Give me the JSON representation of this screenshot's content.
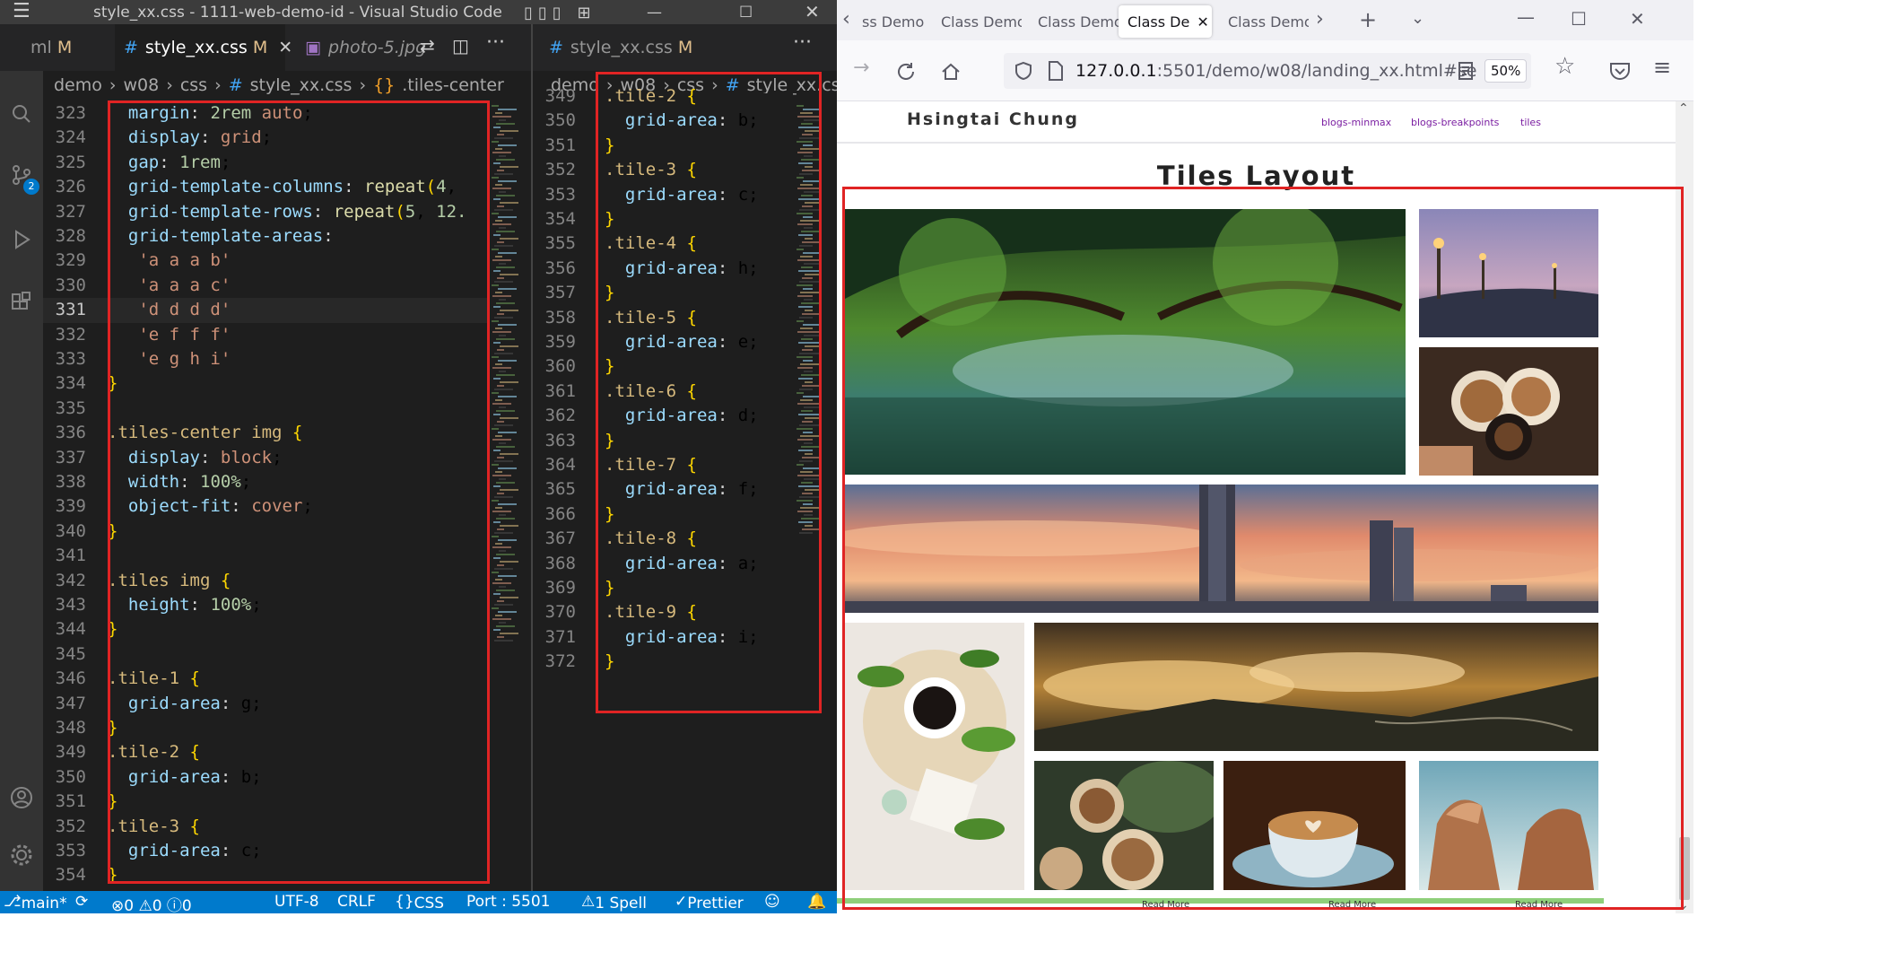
{
  "vscode": {
    "title": "style_xx.css - 1111-web-demo-id - Visual Studio Code",
    "activity_badge": "2",
    "left_group": {
      "tabs": [
        {
          "label": "ml",
          "flag": "M"
        },
        {
          "label": "style_xx.css",
          "flag": "M"
        },
        {
          "label": "photo-5.jpg",
          "flag": ""
        }
      ],
      "breadcrumb": [
        "demo",
        "w08",
        "css",
        "style_xx.css",
        ".tiles-center"
      ]
    },
    "right_group": {
      "tab": {
        "label": "style_xx.css",
        "flag": "M"
      },
      "breadcrumb": [
        "demo",
        "w08",
        "css",
        "style_xx.css"
      ]
    },
    "left_lines": [
      {
        "n": "323",
        "code": "  margin: 2rem auto;"
      },
      {
        "n": "324",
        "code": "  display: grid;"
      },
      {
        "n": "325",
        "code": "  gap: 1rem;"
      },
      {
        "n": "326",
        "code": "  grid-template-columns: repeat(4,"
      },
      {
        "n": "327",
        "code": "  grid-template-rows: repeat(5, 12."
      },
      {
        "n": "328",
        "code": "  grid-template-areas:"
      },
      {
        "n": "329",
        "code": "   'a a a b'"
      },
      {
        "n": "330",
        "code": "   'a a a c'"
      },
      {
        "n": "331",
        "code": "   'd d d d'"
      },
      {
        "n": "332",
        "code": "   'e f f f'"
      },
      {
        "n": "333",
        "code": "   'e g h i'"
      },
      {
        "n": "334",
        "code": "}"
      },
      {
        "n": "335",
        "code": ""
      },
      {
        "n": "336",
        "code": ".tiles-center img {"
      },
      {
        "n": "337",
        "code": "  display: block;"
      },
      {
        "n": "338",
        "code": "  width: 100%;"
      },
      {
        "n": "339",
        "code": "  object-fit: cover;"
      },
      {
        "n": "340",
        "code": "}"
      },
      {
        "n": "341",
        "code": ""
      },
      {
        "n": "342",
        "code": ".tiles img {"
      },
      {
        "n": "343",
        "code": "  height: 100%;"
      },
      {
        "n": "344",
        "code": "}"
      },
      {
        "n": "345",
        "code": ""
      },
      {
        "n": "346",
        "code": ".tile-1 {"
      },
      {
        "n": "347",
        "code": "  grid-area: g;"
      },
      {
        "n": "348",
        "code": "}"
      },
      {
        "n": "349",
        "code": ".tile-2 {"
      },
      {
        "n": "350",
        "code": "  grid-area: b;"
      },
      {
        "n": "351",
        "code": "}"
      },
      {
        "n": "352",
        "code": ".tile-3 {"
      },
      {
        "n": "353",
        "code": "  grid-area: c;"
      },
      {
        "n": "354",
        "code": "}"
      }
    ],
    "right_lines": [
      {
        "n": "349",
        "code": ".tile-2 {"
      },
      {
        "n": "350",
        "code": "  grid-area: b;"
      },
      {
        "n": "351",
        "code": "}"
      },
      {
        "n": "352",
        "code": ".tile-3 {"
      },
      {
        "n": "353",
        "code": "  grid-area: c;"
      },
      {
        "n": "354",
        "code": "}"
      },
      {
        "n": "355",
        "code": ".tile-4 {"
      },
      {
        "n": "356",
        "code": "  grid-area: h;"
      },
      {
        "n": "357",
        "code": "}"
      },
      {
        "n": "358",
        "code": ".tile-5 {"
      },
      {
        "n": "359",
        "code": "  grid-area: e;"
      },
      {
        "n": "360",
        "code": "}"
      },
      {
        "n": "361",
        "code": ".tile-6 {"
      },
      {
        "n": "362",
        "code": "  grid-area: d;"
      },
      {
        "n": "363",
        "code": "}"
      },
      {
        "n": "364",
        "code": ".tile-7 {"
      },
      {
        "n": "365",
        "code": "  grid-area: f;"
      },
      {
        "n": "366",
        "code": "}"
      },
      {
        "n": "367",
        "code": ".tile-8 {"
      },
      {
        "n": "368",
        "code": "  grid-area: a;"
      },
      {
        "n": "369",
        "code": "}"
      },
      {
        "n": "370",
        "code": ".tile-9 {"
      },
      {
        "n": "371",
        "code": "  grid-area: i;"
      },
      {
        "n": "372",
        "code": "}"
      }
    ],
    "current_line": "331",
    "status": {
      "branch": "main*",
      "encoding": "UTF-8",
      "eol": "CRLF",
      "language": "CSS",
      "port": "Port : 5501",
      "spell": "1 Spell",
      "prettier": "Prettier"
    },
    "colors": {
      "status_bar": "#007acc",
      "highlight_box": "#e02424"
    }
  },
  "firefox": {
    "tabs": [
      "ss Demo",
      "Class Demo",
      "Class Demo",
      "Class De",
      "Class Demo"
    ],
    "active_tab_index": 3,
    "url_host": "127.0.0.1",
    "url_rest": ":5501/demo/w08/landing_xx.html#se",
    "zoom": "50%"
  },
  "page": {
    "brand": "Hsingtai Chung",
    "nav_links": [
      "blogs-minmax",
      "blogs-breakpoints",
      "tiles"
    ],
    "title": "Tiles Layout",
    "read_more": "Read More",
    "tiles": [
      {
        "name": "tile-mangrove-river",
        "subject": "mangrove river"
      },
      {
        "name": "tile-bridge-lamps",
        "subject": "bridge with lamps at dusk"
      },
      {
        "name": "tile-coffee-cheers",
        "subject": "latte cups toasting"
      },
      {
        "name": "tile-taipei-101-skyline",
        "subject": "city skyline at sunset"
      },
      {
        "name": "tile-coffee-leaves",
        "subject": "coffee with leaves flat lay"
      },
      {
        "name": "tile-mountain-clouds",
        "subject": "mountains above clouds"
      },
      {
        "name": "tile-latte-art-cups",
        "subject": "latte art cups"
      },
      {
        "name": "tile-heart-latte",
        "subject": "heart latte in blue cup"
      },
      {
        "name": "tile-queens-head-rock",
        "subject": "rock formation"
      }
    ]
  }
}
